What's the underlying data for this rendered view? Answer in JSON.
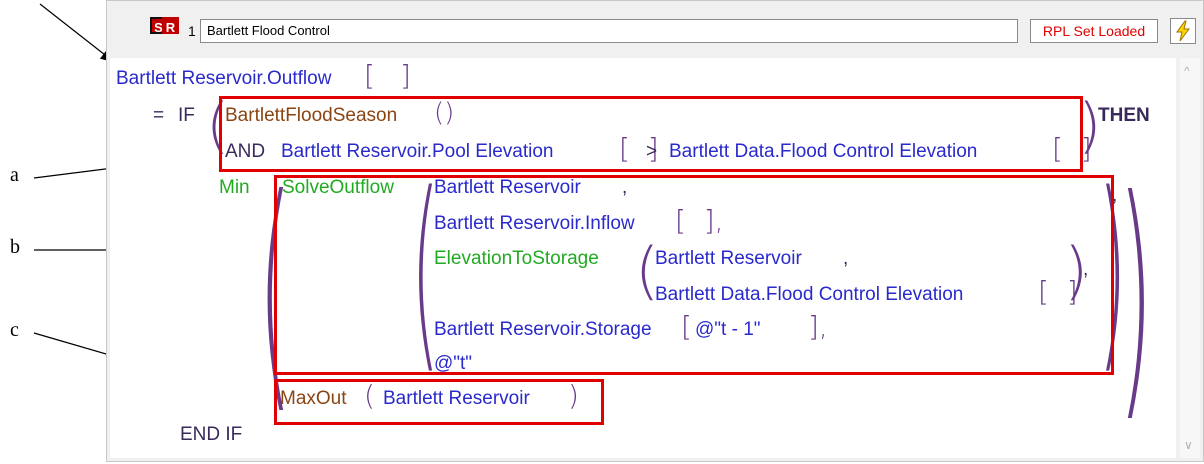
{
  "toolbar": {
    "s_icon": "S",
    "r_icon": "R",
    "row_number": "1",
    "rule_name": "Bartlett Flood Control",
    "status": "RPL Set Loaded"
  },
  "code": {
    "target": "Bartlett Reservoir.Outflow",
    "eq": "=",
    "if": "IF",
    "flood_season_func": "BartlettFloodSeason",
    "and": "AND",
    "pool_elev": "Bartlett Reservoir.Pool Elevation",
    "gt": ">",
    "flood_ctrl_elev": "Bartlett Data.Flood Control Elevation",
    "then": "THEN",
    "min": "Min",
    "solve_outflow": "SolveOutflow",
    "reservoir": "Bartlett Reservoir",
    "inflow": "Bartlett Reservoir.Inflow",
    "elev_to_storage": "ElevationToStorage",
    "storage": "Bartlett Reservoir.Storage",
    "t_minus_1": "@\"t - 1\"",
    "t": "@\"t\"",
    "maxout": "MaxOut",
    "end_if": "END IF"
  },
  "annotations": {
    "a": "a",
    "b": "b",
    "c": "c"
  }
}
